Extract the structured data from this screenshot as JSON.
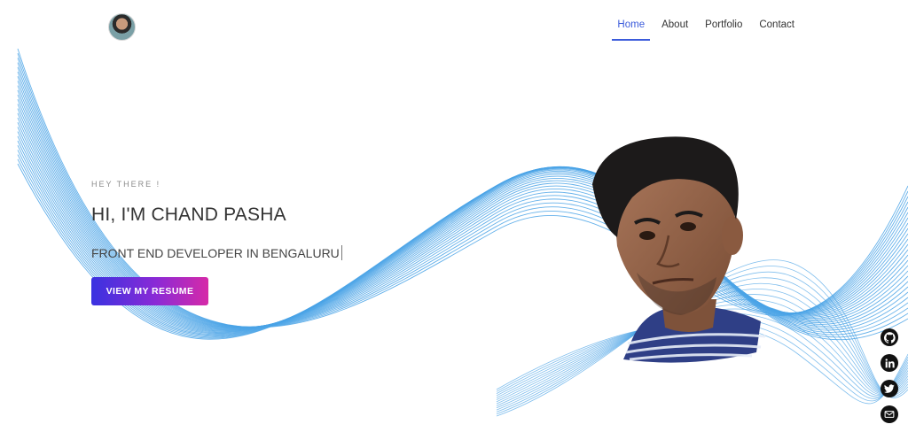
{
  "header": {
    "avatar_icon": "profile-avatar",
    "nav": [
      {
        "label": "Home",
        "active": true
      },
      {
        "label": "About",
        "active": false
      },
      {
        "label": "Portfolio",
        "active": false
      },
      {
        "label": "Contact",
        "active": false
      }
    ]
  },
  "hero": {
    "eyebrow": "HEY THERE !",
    "name": "HI, I'M CHAND PASHA",
    "role": "FRONT END DEVELOPER IN BENGALURU",
    "cta_label": "VIEW MY RESUME"
  },
  "portrait": {
    "icon": "developer-portrait"
  },
  "social": [
    {
      "icon": "github-icon"
    },
    {
      "icon": "linkedin-icon"
    },
    {
      "icon": "twitter-icon"
    },
    {
      "icon": "mail-icon"
    }
  ],
  "colors": {
    "accent": "#3b5bdb",
    "wave": "#4aa3e6",
    "button_start": "#3a32e0",
    "button_end": "#d62aa8",
    "text": "#333333"
  }
}
